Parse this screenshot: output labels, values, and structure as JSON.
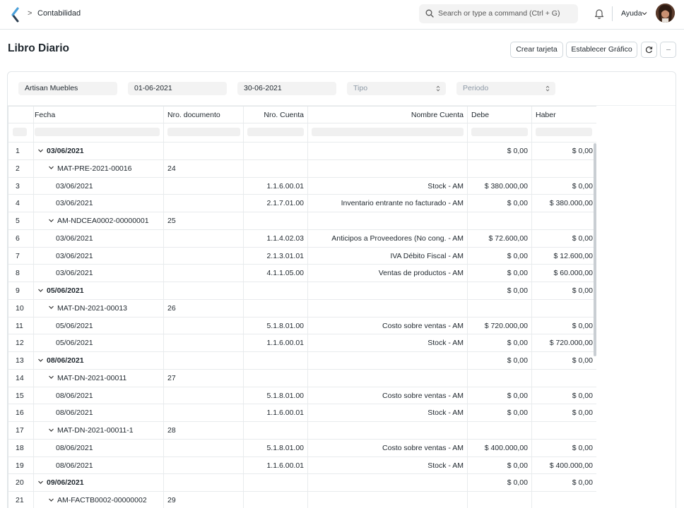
{
  "navbar": {
    "breadcrumb": "Contabilidad",
    "search_placeholder": "Search or type a command (Ctrl + G)",
    "help_label": "Ayuda"
  },
  "page": {
    "title": "Libro Diario",
    "create_card_label": "Crear tarjeta",
    "set_chart_label": "Establecer Gráfico",
    "more_label": "···"
  },
  "filters": {
    "company": "Artisan Muebles",
    "from_date": "01-06-2021",
    "to_date": "30-06-2021",
    "type_placeholder": "Tipo",
    "period_placeholder": "Periodo"
  },
  "table": {
    "columns": [
      "Fecha",
      "Nro. documento",
      "Nro. Cuenta",
      "Nombre Cuenta",
      "Debe",
      "Haber"
    ],
    "rows": [
      {
        "n": "1",
        "level": 0,
        "fecha": "03/06/2021",
        "doc": "",
        "cuenta": "",
        "nombre": "",
        "debe": "$ 0,00",
        "haber": "$ 0,00"
      },
      {
        "n": "2",
        "level": 1,
        "fecha": "MAT-PRE-2021-00016",
        "doc": "24",
        "cuenta": "",
        "nombre": "",
        "debe": "",
        "haber": ""
      },
      {
        "n": "3",
        "level": 2,
        "fecha": "03/06/2021",
        "doc": "",
        "cuenta": "1.1.6.00.01",
        "nombre": "Stock - AM",
        "debe": "$ 380.000,00",
        "haber": "$ 0,00"
      },
      {
        "n": "4",
        "level": 2,
        "fecha": "03/06/2021",
        "doc": "",
        "cuenta": "2.1.7.01.00",
        "nombre": "Inventario entrante no facturado - AM",
        "debe": "$ 0,00",
        "haber": "$ 380.000,00"
      },
      {
        "n": "5",
        "level": 1,
        "fecha": "AM-NDCEA0002-00000001",
        "doc": "25",
        "cuenta": "",
        "nombre": "",
        "debe": "",
        "haber": ""
      },
      {
        "n": "6",
        "level": 2,
        "fecha": "03/06/2021",
        "doc": "",
        "cuenta": "1.1.4.02.03",
        "nombre": "Anticipos a Proveedores (No cong. - AM",
        "debe": "$ 72.600,00",
        "haber": "$ 0,00"
      },
      {
        "n": "7",
        "level": 2,
        "fecha": "03/06/2021",
        "doc": "",
        "cuenta": "2.1.3.01.01",
        "nombre": "IVA Débito Fiscal - AM",
        "debe": "$ 0,00",
        "haber": "$ 12.600,00"
      },
      {
        "n": "8",
        "level": 2,
        "fecha": "03/06/2021",
        "doc": "",
        "cuenta": "4.1.1.05.00",
        "nombre": "Ventas de productos - AM",
        "debe": "$ 0,00",
        "haber": "$ 60.000,00"
      },
      {
        "n": "9",
        "level": 0,
        "fecha": "05/06/2021",
        "doc": "",
        "cuenta": "",
        "nombre": "",
        "debe": "$ 0,00",
        "haber": "$ 0,00"
      },
      {
        "n": "10",
        "level": 1,
        "fecha": "MAT-DN-2021-00013",
        "doc": "26",
        "cuenta": "",
        "nombre": "",
        "debe": "",
        "haber": ""
      },
      {
        "n": "11",
        "level": 2,
        "fecha": "05/06/2021",
        "doc": "",
        "cuenta": "5.1.8.01.00",
        "nombre": "Costo sobre ventas - AM",
        "debe": "$ 720.000,00",
        "haber": "$ 0,00"
      },
      {
        "n": "12",
        "level": 2,
        "fecha": "05/06/2021",
        "doc": "",
        "cuenta": "1.1.6.00.01",
        "nombre": "Stock - AM",
        "debe": "$ 0,00",
        "haber": "$ 720.000,00"
      },
      {
        "n": "13",
        "level": 0,
        "fecha": "08/06/2021",
        "doc": "",
        "cuenta": "",
        "nombre": "",
        "debe": "$ 0,00",
        "haber": "$ 0,00"
      },
      {
        "n": "14",
        "level": 1,
        "fecha": "MAT-DN-2021-00011",
        "doc": "27",
        "cuenta": "",
        "nombre": "",
        "debe": "",
        "haber": ""
      },
      {
        "n": "15",
        "level": 2,
        "fecha": "08/06/2021",
        "doc": "",
        "cuenta": "5.1.8.01.00",
        "nombre": "Costo sobre ventas - AM",
        "debe": "$ 0,00",
        "haber": "$ 0,00"
      },
      {
        "n": "16",
        "level": 2,
        "fecha": "08/06/2021",
        "doc": "",
        "cuenta": "1.1.6.00.01",
        "nombre": "Stock - AM",
        "debe": "$ 0,00",
        "haber": "$ 0,00"
      },
      {
        "n": "17",
        "level": 1,
        "fecha": "MAT-DN-2021-00011-1",
        "doc": "28",
        "cuenta": "",
        "nombre": "",
        "debe": "",
        "haber": ""
      },
      {
        "n": "18",
        "level": 2,
        "fecha": "08/06/2021",
        "doc": "",
        "cuenta": "5.1.8.01.00",
        "nombre": "Costo sobre ventas - AM",
        "debe": "$ 400.000,00",
        "haber": "$ 0,00"
      },
      {
        "n": "19",
        "level": 2,
        "fecha": "08/06/2021",
        "doc": "",
        "cuenta": "1.1.6.00.01",
        "nombre": "Stock - AM",
        "debe": "$ 0,00",
        "haber": "$ 400.000,00"
      },
      {
        "n": "20",
        "level": 0,
        "fecha": "09/06/2021",
        "doc": "",
        "cuenta": "",
        "nombre": "",
        "debe": "$ 0,00",
        "haber": "$ 0,00"
      },
      {
        "n": "21",
        "level": 1,
        "fecha": "AM-FACTB0002-00000002",
        "doc": "29",
        "cuenta": "",
        "nombre": "",
        "debe": "",
        "haber": ""
      }
    ]
  }
}
